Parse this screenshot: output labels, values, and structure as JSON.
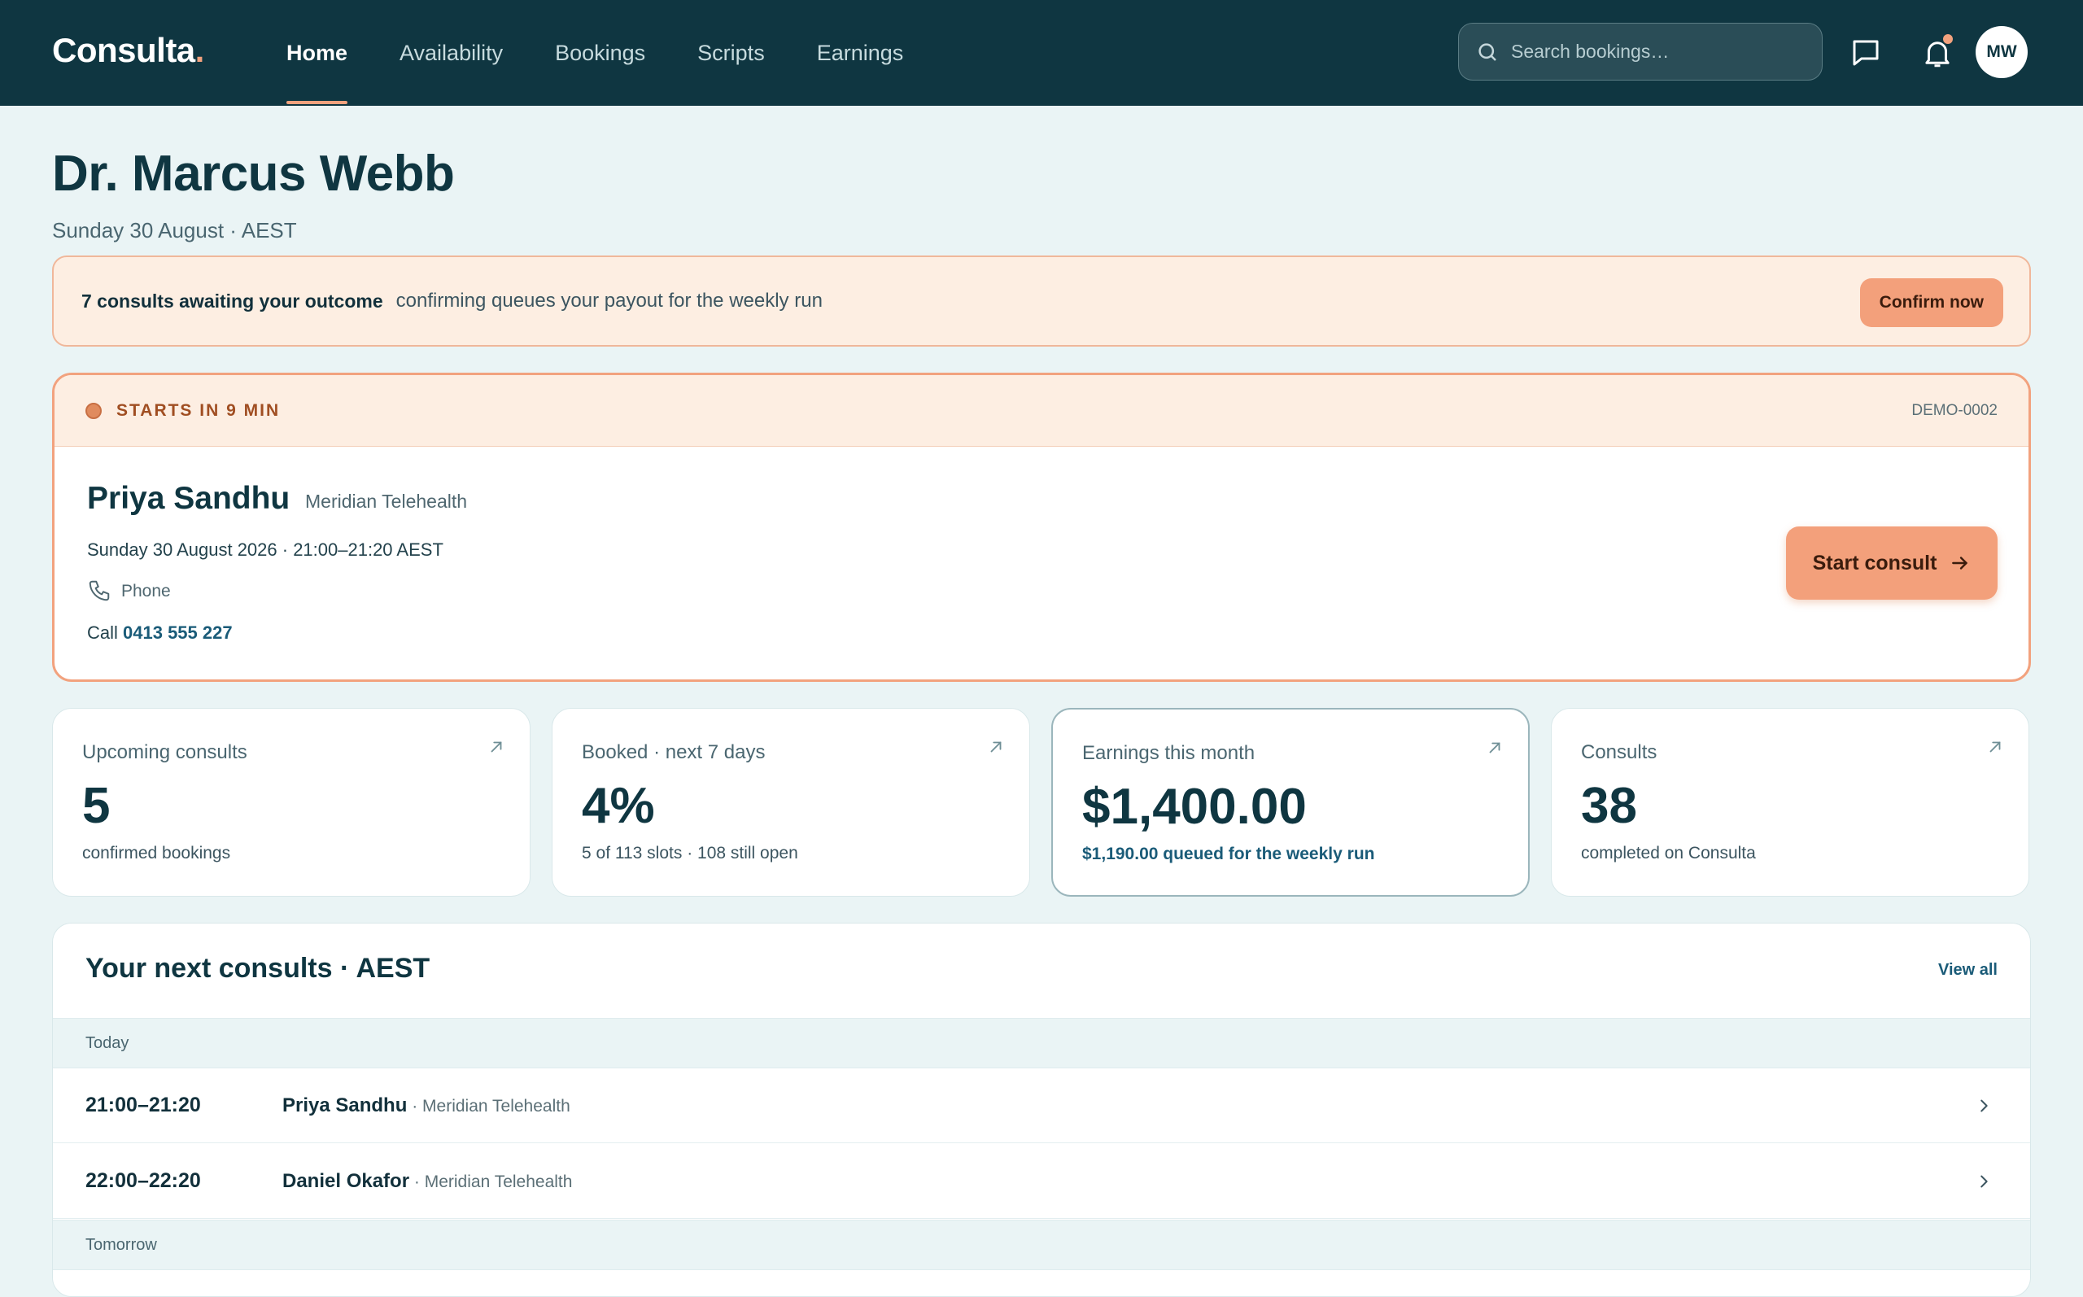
{
  "brand": {
    "name": "Consulta",
    "dot": "."
  },
  "nav": {
    "items": [
      {
        "label": "Home",
        "active": true
      },
      {
        "label": "Availability",
        "active": false
      },
      {
        "label": "Bookings",
        "active": false
      },
      {
        "label": "Scripts",
        "active": false
      },
      {
        "label": "Earnings",
        "active": false
      }
    ]
  },
  "search": {
    "placeholder": "Search bookings…"
  },
  "user": {
    "initials": "MW"
  },
  "header": {
    "title": "Dr. Marcus Webb",
    "subtitle": "Sunday 30 August · AEST"
  },
  "banner": {
    "strong": "7 consults awaiting your outcome",
    "text": "confirming queues your payout for the weekly run",
    "button": "Confirm now"
  },
  "next_consult": {
    "status": "STARTS IN 9 MIN",
    "id": "DEMO-0002",
    "patient": "Priya Sandhu",
    "org": "Meridian Telehealth",
    "when": "Sunday 30 August 2026 · 21:00–21:20 AEST",
    "mode": "Phone",
    "call_prefix": "Call ",
    "phone": "0413 555 227",
    "button": "Start consult"
  },
  "stats": [
    {
      "label": "Upcoming consults",
      "value": "5",
      "sub": "confirmed bookings"
    },
    {
      "label": "Booked · next 7 days",
      "value": "4%",
      "sub": "5 of 113 slots · 108 still open"
    },
    {
      "label": "Earnings this month",
      "value": "$1,400.00",
      "sub": "$1,190.00 queued for the weekly run"
    },
    {
      "label": "Consults",
      "value": "38",
      "sub": "completed on Consulta"
    }
  ],
  "schedule": {
    "title": "Your next consults · AEST",
    "view_all": "View all",
    "groups": [
      {
        "label": "Today",
        "rows": [
          {
            "time": "21:00–21:20",
            "name": "Priya Sandhu",
            "org": " · Meridian Telehealth"
          },
          {
            "time": "22:00–22:20",
            "name": "Daniel Okafor",
            "org": " · Meridian Telehealth"
          }
        ]
      },
      {
        "label": "Tomorrow",
        "rows": []
      }
    ]
  },
  "colors": {
    "nav_bg": "#0f3641",
    "accent": "#f2a27e",
    "page_bg": "#eaf4f5"
  }
}
